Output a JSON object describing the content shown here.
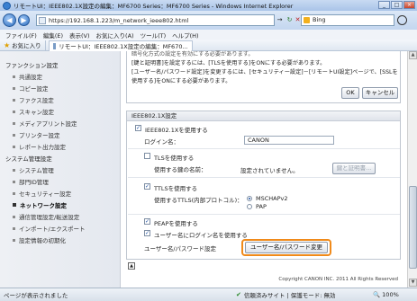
{
  "window": {
    "title": "リモートUI：IEEE802.1X設定の編集：MF6700 Series：MF6700 Series - Windows Internet Explorer",
    "buttons": [
      "_",
      "□",
      "×"
    ]
  },
  "nav": {
    "back": "◀",
    "forward": "▶",
    "url": "https://192.168.1.223/m_network_ieee802.html",
    "go": "→",
    "refresh": "↻",
    "stop": "✕",
    "search_engine": "Bing",
    "icons": [
      "back-icon",
      "forward-icon",
      "refresh-icon",
      "stop-icon",
      "search-icon"
    ]
  },
  "menu": [
    "ファイル(F)",
    "編集(E)",
    "表示(V)",
    "お気に入り(A)",
    "ツール(T)",
    "ヘルプ(H)"
  ],
  "favbar": {
    "favorites": "お気に入り",
    "tab_title": "リモートUI：IEEE802.1X設定の編集：MF670..."
  },
  "sidebar": {
    "sections": [
      {
        "label": "ファンクション設定",
        "items": [
          "共通設定",
          "コピー設定",
          "ファクス設定",
          "スキャン設定",
          "メディアプリント設定",
          "プリンター設定",
          "レポート出力設定"
        ]
      },
      {
        "label": "システム管理設定",
        "items": [
          "システム管理",
          "部門ID管理",
          "セキュリティー設定",
          "ネットワーク設定",
          "通信管理設定/転送設定",
          "インポート/エクスポート",
          "設定情報の初期化"
        ]
      }
    ],
    "active": "ネットワーク設定"
  },
  "notes": {
    "line0": "暗号化方式の設定を有効にする必要があります。",
    "line1": "[鍵と証明書]を設定するには、[TLSを使用する]をONにする必要があります。",
    "line2": "[ユーザー名/パスワード設定]を変更するには、[セキュリティー設定]－[リモートUI設定]ページで、[SSLを",
    "line3": "使用する]をONにする必要があります。",
    "ok": "OK",
    "cancel": "キャンセル"
  },
  "panel": {
    "header": "IEEE802.1X設定",
    "use_ieee": "IEEE802.1Xを使用する",
    "login_label": "ログイン名：",
    "login_value": "CANON",
    "use_tls": "TLSを使用する",
    "key_label": "使用する鍵の名前：",
    "key_value": "設定されていません。",
    "key_button": "鍵と証明書...",
    "use_ttls": "TTLSを使用する",
    "ttls_label": "使用するTTLS(内部プロトコル)：",
    "mschap": "MSCHAPv2",
    "pap": "PAP",
    "use_peap": "PEAPを使用する",
    "same_user": "ユーザー名にログイン名を使用する",
    "userpass_label": "ユーザー名/パスワード設定",
    "userpass_button": "ユーザー名/パスワード変更",
    "check": "✓"
  },
  "copyright": "Copyright CANON INC. 2011 All Rights Reserved",
  "status": {
    "text": "ページが表示されました",
    "zone": "信頼済みサイト | 保護モード: 無効",
    "zoom": "100%"
  },
  "colors": {
    "highlight": "#f08a1a",
    "accent": "#1b4fa0"
  }
}
